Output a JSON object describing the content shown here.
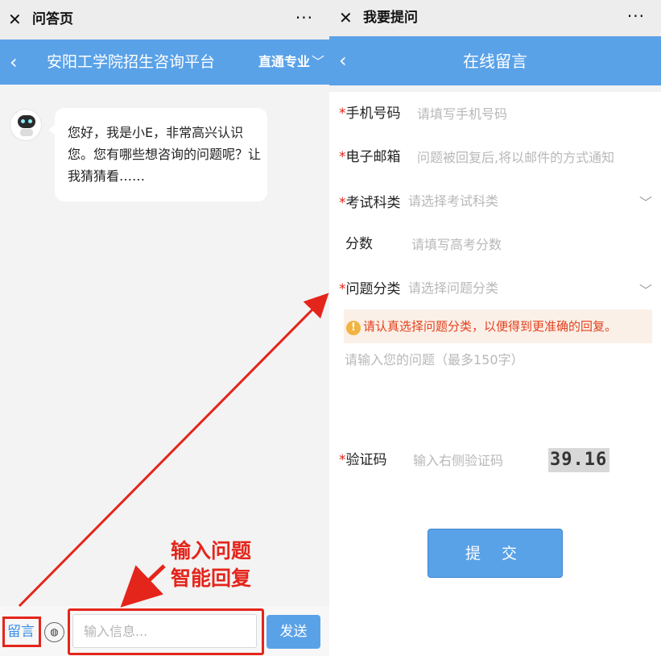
{
  "left": {
    "wx_title": "问答页",
    "wx_more": "···",
    "header_title": "安阳工学院招生咨询平台",
    "header_right": "直通专业",
    "bot_message": "您好，我是小E，非常高兴认识您。您有哪些想咨询的问题呢？让我猜猜看……",
    "leave_message": "留言",
    "input_placeholder": "输入信息...",
    "send": "发送",
    "annotation_line1": "输入问题",
    "annotation_line2": "智能回复"
  },
  "right": {
    "wx_title": "我要提问",
    "wx_more": "···",
    "header_title": "在线留言",
    "fields": {
      "phone": {
        "label": "手机号码",
        "placeholder": "请填写手机号码"
      },
      "email": {
        "label": "电子邮箱",
        "placeholder": "问题被回复后,将以邮件的方式通知"
      },
      "exam_type": {
        "label": "考试科类",
        "placeholder": "请选择考试科类"
      },
      "score": {
        "label": "分数",
        "placeholder": "请填写高考分数"
      },
      "category": {
        "label": "问题分类",
        "placeholder": "请选择问题分类"
      },
      "question": {
        "placeholder": "请输入您的问题（最多150字）"
      },
      "captcha": {
        "label": "验证码",
        "placeholder": "输入右侧验证码",
        "image_text": "39.16"
      }
    },
    "tip": "请认真选择问题分类，以便得到更准确的回复。",
    "submit": "提 交"
  },
  "colors": {
    "brand_blue": "#5aa2e8",
    "annotation_red": "#e4251b",
    "required_star": "#e4251b"
  }
}
